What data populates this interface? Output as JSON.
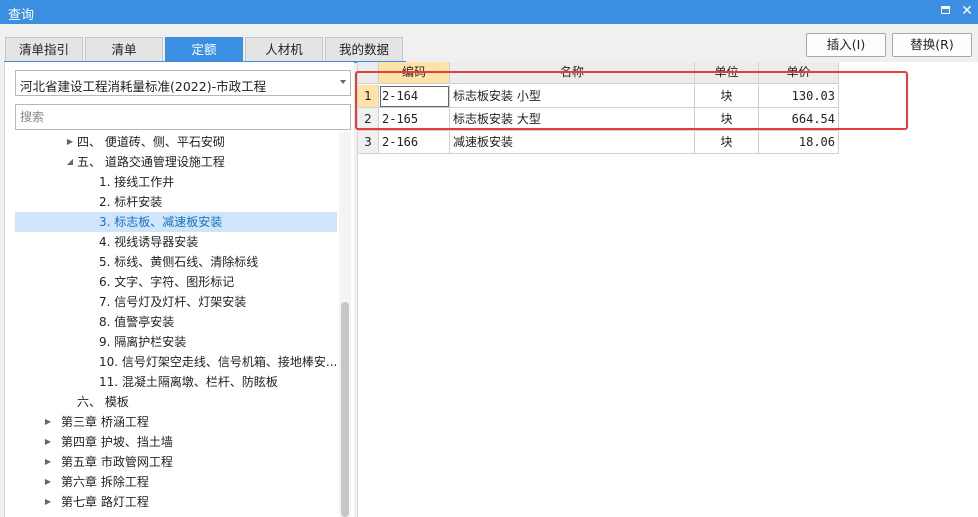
{
  "window": {
    "title": "查询"
  },
  "tabs": [
    "清单指引",
    "清单",
    "定额",
    "人材机",
    "我的数据"
  ],
  "active_tab": 2,
  "buttons": {
    "insert": "插入(I)",
    "replace": "替换(R)"
  },
  "selector": {
    "value": "河北省建设工程消耗量标准(2022)-市政工程"
  },
  "search": {
    "placeholder": "搜索"
  },
  "tree": [
    {
      "label": "四、 便道砖、侧、平石安砌",
      "caret": "▶",
      "level": 1
    },
    {
      "label": "五、 道路交通管理设施工程",
      "caret": "◢",
      "level": 1
    },
    {
      "label": "1. 接线工作井",
      "caret": "",
      "level": 2
    },
    {
      "label": "2. 标杆安装",
      "caret": "",
      "level": 2
    },
    {
      "label": "3. 标志板、减速板安装",
      "caret": "",
      "level": 2,
      "selected": true
    },
    {
      "label": "4. 视线诱导器安装",
      "caret": "",
      "level": 2
    },
    {
      "label": "5. 标线、黄侧石线、清除标线",
      "caret": "",
      "level": 2
    },
    {
      "label": "6. 文字、字符、图形标记",
      "caret": "",
      "level": 2
    },
    {
      "label": "7. 信号灯及灯杆、灯架安装",
      "caret": "",
      "level": 2
    },
    {
      "label": "8. 值警亭安装",
      "caret": "",
      "level": 2
    },
    {
      "label": "9. 隔离护栏安装",
      "caret": "",
      "level": 2
    },
    {
      "label": "10. 信号灯架空走线、信号机箱、接地棒安...",
      "caret": "",
      "level": 2
    },
    {
      "label": "11. 混凝土隔离墩、栏杆、防眩板",
      "caret": "",
      "level": 2
    },
    {
      "label": "六、 模板",
      "caret": "",
      "level": 1
    },
    {
      "label": "第三章 桥涵工程",
      "caret": "▶",
      "level": 0
    },
    {
      "label": "第四章 护坡、挡土墙",
      "caret": "▶",
      "level": 0
    },
    {
      "label": "第五章 市政管网工程",
      "caret": "▶",
      "level": 0
    },
    {
      "label": "第六章 拆除工程",
      "caret": "▶",
      "level": 0
    },
    {
      "label": "第七章 路灯工程",
      "caret": "▶",
      "level": 0
    }
  ],
  "grid": {
    "columns": [
      "编码",
      "名称",
      "单位",
      "单价"
    ],
    "rows": [
      {
        "num": "1",
        "code": "2-164",
        "name": "标志板安装 小型",
        "unit": "块",
        "price": "130.03"
      },
      {
        "num": "2",
        "code": "2-165",
        "name": "标志板安装 大型",
        "unit": "块",
        "price": "664.54"
      },
      {
        "num": "3",
        "code": "2-166",
        "name": "减速板安装",
        "unit": "块",
        "price": "18.06"
      }
    ]
  },
  "colors": {
    "accent": "#3b8fe3",
    "highlight": "#e83b3b",
    "selected_row": "#cfe5fa",
    "header_key": "#ffe3a8"
  },
  "icons": {
    "maximize": "maximize-icon",
    "close": "close-icon",
    "dropdown": "chevron-down-icon",
    "expand": "caret-right-icon",
    "collapse": "caret-down-icon"
  }
}
